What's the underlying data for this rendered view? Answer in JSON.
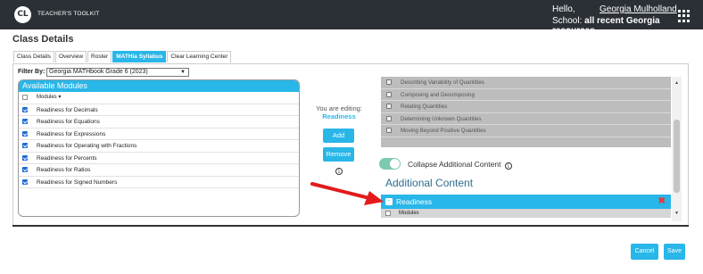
{
  "header": {
    "logo_initials": "CL",
    "app_name": "TEACHER'S TOOLKIT",
    "greeting": "Hello,",
    "user_name": "Georgia Mulholland",
    "school_label": "School:",
    "school_value": "all recent Georgia resources",
    "apps_icon": "grid-icon"
  },
  "page": {
    "title": "Class Details"
  },
  "tabs": [
    {
      "label": "Class Details",
      "active": false
    },
    {
      "label": "Overview",
      "active": false
    },
    {
      "label": "Roster",
      "active": false
    },
    {
      "label": "MATHia Syllabus",
      "active": true
    },
    {
      "label": "Clear Learning Center",
      "active": false
    }
  ],
  "filter": {
    "label": "Filter By:",
    "selected": "Georgia MATHbook Grade 6 (2023)"
  },
  "available_modules": {
    "title": "Available Modules",
    "column_header": "Modules ▾",
    "items": [
      {
        "label": "Readiness for Decimals",
        "checked": true
      },
      {
        "label": "Readiness for Equations",
        "checked": true
      },
      {
        "label": "Readiness for Expressions",
        "checked": true
      },
      {
        "label": "Readiness for Operating with Fractions",
        "checked": true
      },
      {
        "label": "Readiness for Percents",
        "checked": true
      },
      {
        "label": "Readiness for Ratios",
        "checked": true
      },
      {
        "label": "Readiness for Signed Numbers",
        "checked": true
      }
    ]
  },
  "editing": {
    "label": "You are editing:",
    "value": "Readiness",
    "add_label": "Add",
    "remove_label": "Remove",
    "info_symbol": "i"
  },
  "selected_modules": {
    "items": [
      {
        "label": "Describing Variability of Quantities"
      },
      {
        "label": "Composing and Decomposing"
      },
      {
        "label": "Relating Quantities"
      },
      {
        "label": "Determining Unknown Quantities"
      },
      {
        "label": "Moving Beyond Positive Quantities"
      }
    ]
  },
  "collapse": {
    "label": "Collapse Additional Content",
    "on": true
  },
  "additional_content": {
    "title": "Additional Content",
    "group_label": "Readiness",
    "expand_symbol": "-",
    "remove_symbol": "✖",
    "column_header": "Modules"
  },
  "footer": {
    "cancel_label": "Cancel",
    "save_label": "Save"
  },
  "colors": {
    "accent": "#29b6e8",
    "topbar": "#2b3036",
    "annotation_arrow": "#e31b1b"
  }
}
